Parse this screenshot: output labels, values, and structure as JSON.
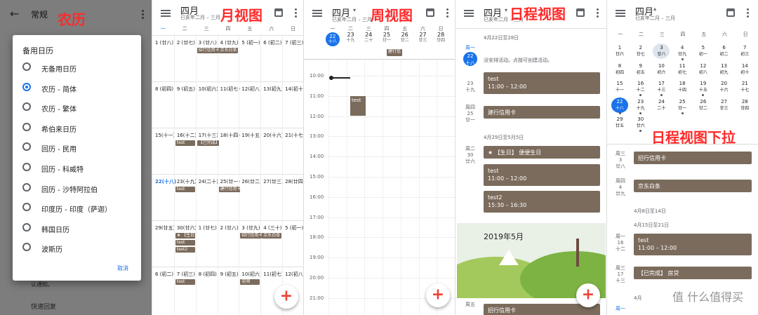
{
  "labels": {
    "p1": "农历",
    "p2": "月视图",
    "p3": "周视图",
    "p4": "日程视图",
    "p5": "日程视图下拉"
  },
  "settings": {
    "title": "常规",
    "dialog_title": "备用日历",
    "options": [
      "无备用日历",
      "农历 - 简体",
      "农历 - 繁体",
      "希伯来日历",
      "回历 - 民用",
      "回历 - 科威特",
      "回历 - 沙特阿拉伯",
      "印度历 - 印度（萨迦）",
      "韩国日历",
      "波斯历"
    ],
    "selected_index": 1,
    "cancel": "取消",
    "bg_text_1": "认通知。",
    "bg_text_2": "快速回复"
  },
  "header": {
    "month": "四月",
    "sub": "已亥年二月 – 三月"
  },
  "weekdays": [
    "一",
    "二",
    "三",
    "四",
    "五",
    "六",
    "日"
  ],
  "monthview": {
    "rows": [
      [
        "1 (廿八)",
        "2 (廿七)",
        "3 (廿八)",
        "4 (廿九)",
        "5 (初一)",
        "6 (初二)",
        "7 (初三)"
      ],
      [
        "8 (初四)",
        "9 (初五)",
        "10(初六)",
        "11(初七)",
        "12(初八)",
        "13(初九)",
        "14(初十)"
      ],
      [
        "15(十一)",
        "16(十二)",
        "17(十三)",
        "18(十四)",
        "19(十五)",
        "20(十六)",
        "21(十七)"
      ],
      [
        "22(十八)",
        "23(十九)",
        "24(二十)",
        "25(廿一)",
        "26(廿二)",
        "27(廿三)",
        "28(廿四)"
      ],
      [
        "29(廿五)",
        "30(廿六)",
        "1 (廿七)",
        "2 (廿八)",
        "3 (廿九)",
        "4 (三十)",
        "5 (初一)"
      ],
      [
        "6 (初二)",
        "7 (初三)",
        "8 (初四)",
        "9 (初五)",
        "10(初六)",
        "11(初七)",
        "12(初八)"
      ]
    ],
    "events": {
      "e1": "招行信用卡",
      "e2": "京东白条",
      "e3": "test",
      "e4": "【已完成】",
      "e5": "test",
      "e6": "建行信用卡",
      "e7": "★ 【生日】",
      "e8": "test",
      "e9": "test2",
      "e10": "招行信用卡",
      "e11": "京东白条",
      "e12": "test",
      "e13": "花呗"
    }
  },
  "weekview": {
    "days": [
      {
        "d": "22",
        "l": "十八"
      },
      {
        "d": "23",
        "l": "十九"
      },
      {
        "d": "24",
        "l": "二十"
      },
      {
        "d": "25",
        "l": "廿一"
      },
      {
        "d": "26",
        "l": "廿二"
      },
      {
        "d": "27",
        "l": "廿三"
      },
      {
        "d": "28",
        "l": "廿四"
      }
    ],
    "allday": "建行信",
    "times": [
      "10:00",
      "11:00",
      "12:00",
      "13:00",
      "14:00",
      "15:00",
      "16:00",
      "17:00",
      "18:00",
      "19:00",
      "20:00",
      "21:00"
    ],
    "event": "test"
  },
  "agenda": {
    "range1": "4月22日至28日",
    "day1_wd": "周一",
    "day1_d": "22",
    "day1_l": "十八",
    "empty": "没安排活动。点按可创建活动。",
    "d23_d": "23",
    "d23_l": "十九",
    "ev1_t": "test",
    "ev1_time": "11:00 – 12:00",
    "d25_wd": "周四",
    "d25_d": "25",
    "d25_l": "廿一",
    "ev2": "建行信用卡",
    "range2": "4月29日至5月5日",
    "d30_wd": "周二",
    "d30_d": "30",
    "d30_l": "廿六",
    "ev3": "★ 【生日】 便便生日",
    "ev4_t": "test",
    "ev4_time": "11:00 – 12:00",
    "ev5_t": "test2",
    "ev5_time": "15:30 – 16:30",
    "banner": "2019年5月",
    "d3_wd": "周五",
    "ev6": "招行信用卡"
  },
  "pulldown": {
    "header_month": "四月",
    "header_sub": "已亥年二月 – 三月",
    "grid": [
      [
        {
          "d": "1",
          "l": "廿六"
        },
        {
          "d": "2",
          "l": "廿七"
        },
        {
          "d": "3",
          "l": "廿八"
        },
        {
          "d": "4",
          "l": "廿九"
        },
        {
          "d": "5",
          "l": "初一"
        },
        {
          "d": "6",
          "l": "初二"
        },
        {
          "d": "7",
          "l": "初三"
        }
      ],
      [
        {
          "d": "8",
          "l": "初四"
        },
        {
          "d": "9",
          "l": "初五"
        },
        {
          "d": "10",
          "l": "初六"
        },
        {
          "d": "11",
          "l": "初七"
        },
        {
          "d": "12",
          "l": "初八"
        },
        {
          "d": "13",
          "l": "初九"
        },
        {
          "d": "14",
          "l": "初十"
        }
      ],
      [
        {
          "d": "15",
          "l": "十一"
        },
        {
          "d": "16",
          "l": "十二"
        },
        {
          "d": "17",
          "l": "十三"
        },
        {
          "d": "18",
          "l": "十四"
        },
        {
          "d": "19",
          "l": "十五"
        },
        {
          "d": "20",
          "l": "十六"
        },
        {
          "d": "21",
          "l": "十七"
        }
      ],
      [
        {
          "d": "22",
          "l": "十八"
        },
        {
          "d": "23",
          "l": "十九"
        },
        {
          "d": "24",
          "l": "二十"
        },
        {
          "d": "25",
          "l": "廿一"
        },
        {
          "d": "26",
          "l": "廿二"
        },
        {
          "d": "27",
          "l": "廿三"
        },
        {
          "d": "28",
          "l": "廿四"
        }
      ],
      [
        {
          "d": "29",
          "l": "廿五"
        },
        {
          "d": "30",
          "l": "廿六"
        },
        {
          "d": "",
          "l": ""
        },
        {
          "d": "",
          "l": ""
        },
        {
          "d": "",
          "l": ""
        },
        {
          "d": "",
          "l": ""
        },
        {
          "d": "",
          "l": ""
        }
      ]
    ],
    "a_wd": "周三",
    "a_d": "3",
    "a_l": "廿八",
    "a_ev": "招行信用卡",
    "b_wd": "周四",
    "b_d": "4",
    "b_l": "廿九",
    "b_ev": "京东白条",
    "range1": "4月8日至14日",
    "range2": "4月15日至21日",
    "c_wd": "周一",
    "c_d": "16",
    "c_l": "十二",
    "c_t": "test",
    "c_time": "11:00 – 12:00",
    "d_wd": "周三",
    "d_d": "17",
    "d_l": "十三",
    "d_ev": "【已完成】 房贷",
    "e_wd": "周一",
    "range3": "4月"
  },
  "watermark": "值 什么值得买",
  "colors": {
    "event": "#7b6b5c",
    "accent": "#1a73e8"
  }
}
